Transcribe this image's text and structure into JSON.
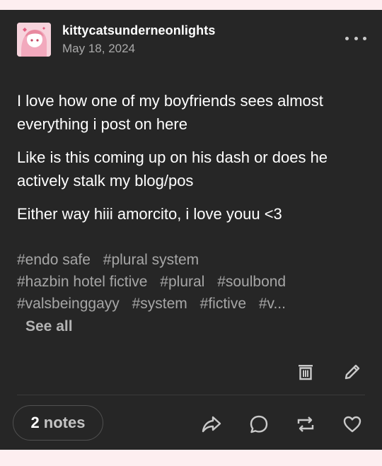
{
  "post": {
    "blog_name": "kittycatsunderneonlights",
    "date": "May 18, 2024",
    "body": [
      "I love how one of my boyfriends sees almost everything i post on here",
      "Like is this coming up on his dash or does he actively stalk my blog/pos",
      "Either way hiii amorcito, i love youu <3"
    ],
    "tags": [
      "#endo safe",
      "#plural system",
      "#hazbin hotel fictive",
      "#plural",
      "#soulbond",
      "#valsbeinggayy",
      "#system",
      "#fictive",
      "#v..."
    ],
    "see_all_label": "See all"
  },
  "footer": {
    "notes_count": "2",
    "notes_label": "notes"
  },
  "icons": {
    "more": "more-icon",
    "delete": "trash-icon",
    "edit": "pencil-icon",
    "share": "share-icon",
    "reply": "reply-icon",
    "reblog": "reblog-icon",
    "like": "heart-icon"
  },
  "colors": {
    "page_background": "#fdeef0",
    "card_background": "#262626",
    "text": "#ffffff",
    "muted_text": "#a6a6a6",
    "icon": "#c9c9c9"
  }
}
